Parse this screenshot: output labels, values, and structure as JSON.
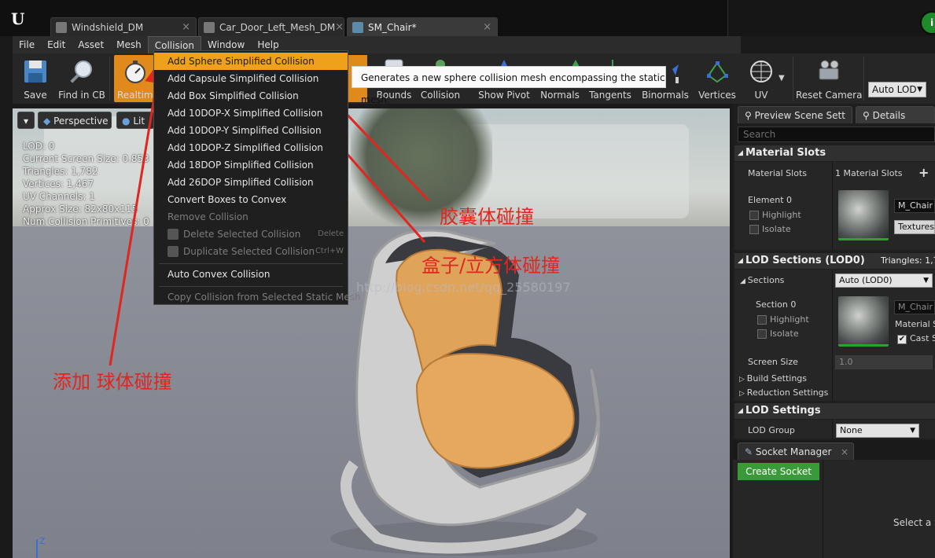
{
  "tabs": [
    {
      "label": "Windshield_DM",
      "close": "×"
    },
    {
      "label": "Car_Door_Left_Mesh_DM",
      "close": "×"
    },
    {
      "label": "SM_Chair*",
      "close": "×"
    }
  ],
  "menubar": [
    "File",
    "Edit",
    "Asset",
    "Mesh",
    "Collision",
    "Window",
    "Help"
  ],
  "toolbar": {
    "save": "Save",
    "find_in_cb": "Find in CB",
    "realtime": "Realtime",
    "bounds": "Bounds",
    "collision": "Collision",
    "show_pivot": "Show Pivot",
    "normals": "Normals",
    "tangents": "Tangents",
    "binormals": "Binormals",
    "vertices": "Vertices",
    "uv": "UV",
    "reset_camera": "Reset Camera",
    "auto_lod": "Auto LOD"
  },
  "collision_menu": {
    "items": [
      {
        "label": "Add Sphere Simplified Collision",
        "highlighted": true
      },
      {
        "label": "Add Capsule Simplified Collision"
      },
      {
        "label": "Add Box Simplified Collision"
      },
      {
        "label": "Add 10DOP-X Simplified Collision"
      },
      {
        "label": "Add 10DOP-Y Simplified Collision"
      },
      {
        "label": "Add 10DOP-Z Simplified Collision"
      },
      {
        "label": "Add 18DOP Simplified Collision"
      },
      {
        "label": "Add 26DOP Simplified Collision"
      },
      {
        "label": "Convert Boxes to Convex"
      },
      {
        "label": "Remove Collision",
        "disabled": true
      },
      {
        "label": "Delete Selected Collision",
        "shortcut": "Delete",
        "disabled": true
      },
      {
        "label": "Duplicate Selected Collision",
        "shortcut": "Ctrl+W",
        "disabled": true
      },
      {
        "label": "Auto Convex Collision"
      },
      {
        "label": "Copy Collision from Selected Static Mesh",
        "disabled": true
      }
    ]
  },
  "tooltip": "Generates a new sphere collision mesh encompassing the static mesh.",
  "viewport": {
    "perspective": "Perspective",
    "lit": "Lit",
    "stats": [
      "LOD:  0",
      "Current Screen Size:  0.853",
      "Triangles:  1,782",
      "Vertices:  1,467",
      "UV Channels:  1",
      "Approx Size: 82x80x115",
      "Num Collision Primitives:  0"
    ],
    "axis_label": "Z",
    "watermark": "http://blog.csdn.net/qq_25580197"
  },
  "annotations": {
    "sphere": "添加 球体碰撞",
    "capsule": "胶囊体碰撞",
    "box": "盒子/立方体碰撞"
  },
  "panel": {
    "tab1": "Preview Scene Sett",
    "tab2": "Details",
    "search_placeholder": "Search",
    "material_slots": {
      "header": "Material Slots",
      "label": "Material Slots",
      "count": "1 Material Slots",
      "element": "Element 0",
      "highlight": "Highlight",
      "isolate": "Isolate",
      "material": "M_Chair",
      "textures": "Textures"
    },
    "lod_sections": {
      "header": "LOD Sections (LOD0)",
      "triangles": "Triangles: 1,78",
      "sections": "Sections",
      "sections_combo": "Auto (LOD0)",
      "section0": "Section 0",
      "highlight": "Highlight",
      "isolate": "Isolate",
      "material": "M_Chair",
      "material_slot": "Material S",
      "cast_shadow": "Cast S",
      "screen_size_label": "Screen Size",
      "screen_size_value": "1.0",
      "build_settings": "Build Settings",
      "reduction_settings": "Reduction Settings"
    },
    "lod_settings": {
      "header": "LOD Settings",
      "lod_group": "LOD Group",
      "lod_group_value": "None"
    },
    "socket_manager": {
      "tab": "Socket Manager",
      "create": "Create Socket",
      "select_hint": "Select a S"
    }
  },
  "colors": {
    "accent": "#f0a11b",
    "annotation": "#e0261e",
    "create_button": "#3a9a3a"
  }
}
